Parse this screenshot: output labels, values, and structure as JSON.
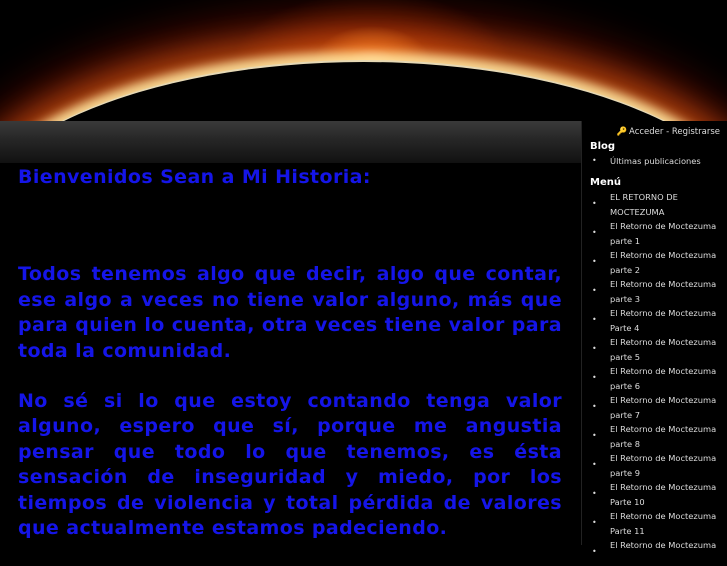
{
  "content": {
    "welcome": "Bienvenidos Sean a Mi Historia:",
    "paragraphs": [
      "Todos tenemos algo que decir, algo que contar, ese algo a veces no tiene valor alguno, más que para quien lo cuenta, otra veces tiene valor para toda la comunidad.",
      "No sé si lo que estoy contando tenga valor alguno, espero que sí, porque me angustia pensar que todo lo que tenemos, es ésta sensación de inseguridad y miedo, por los tiempos de violencia y total pérdida de valores que actualmente estamos padeciendo."
    ]
  },
  "sidebar": {
    "login_text": "Acceder - Registrarse",
    "login_icon": "key-icon",
    "blog_title": "Blog",
    "blog_items": [
      "Últimas publicaciones"
    ],
    "menu_title": "Menú",
    "menu_items": [
      "EL RETORNO DE MOCTEZUMA",
      "El Retorno de Moctezuma parte 1",
      "El Retorno de Moctezuma parte 2",
      "El Retorno de Moctezuma parte 3",
      "El Retorno de Moctezuma Parte 4",
      "El Retorno de Moctezuma parte 5",
      "El Retorno de Moctezuma parte 6",
      "El Retorno de Moctezuma parte 7",
      "El Retorno de Moctezuma parte 8",
      "El Retorno de Moctezuma parte 9",
      "El Retorno de Moctezuma Parte 10",
      "El Retorno de Moctezuma Parte 11",
      "El Retorno de Moctezuma"
    ]
  },
  "colors": {
    "text_blue": "#1515e8",
    "background": "#000000",
    "bar": "#2a2a2a"
  }
}
